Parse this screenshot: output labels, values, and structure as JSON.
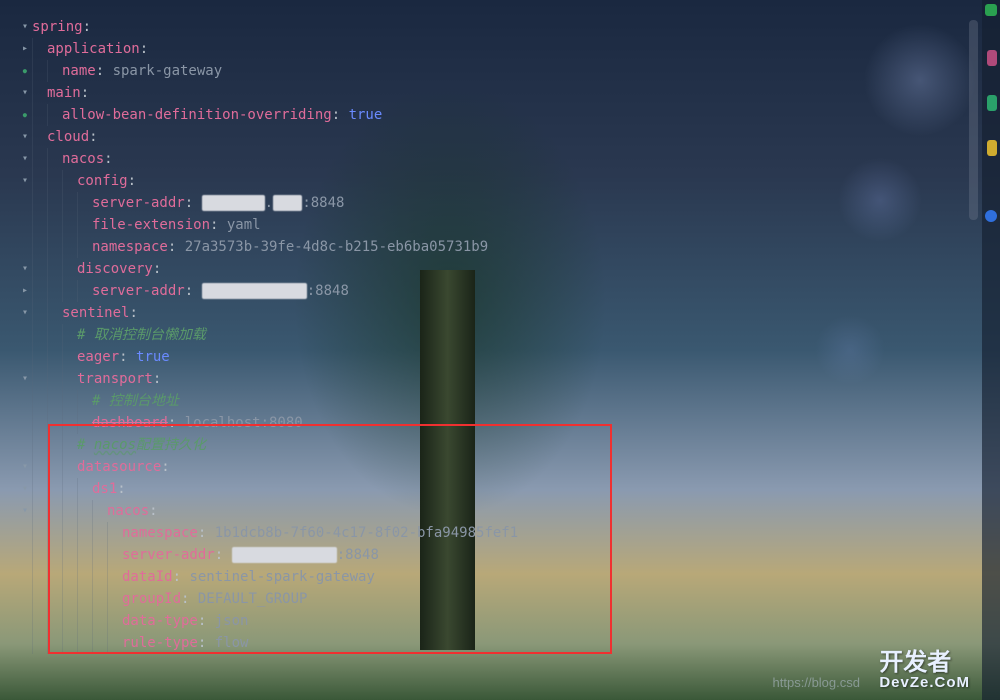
{
  "code": {
    "spring": {
      "application": {
        "name": "spark-gateway"
      },
      "main": {
        "allow_bean_def": "allow-bean-definition-overriding",
        "allow_bean_val": "true"
      },
      "cloud": {
        "nacos": {
          "config": {
            "server_addr_port": ":8848",
            "file_extension": "yaml",
            "namespace": "27a3573b-39fe-4d8c-b215-eb6ba05731b9"
          },
          "discovery": {
            "server_addr_port": ":8848"
          }
        },
        "sentinel": {
          "comment_eager": "# 取消控制台懒加载",
          "eager": "true",
          "transport": {
            "comment_dashboard": "# 控制台地址",
            "dashboard": "localhost:8080"
          },
          "comment_nacos_1": "# ",
          "comment_nacos_2": "nacos",
          "comment_nacos_3": "配置持久化",
          "datasource": {
            "ds1": {
              "nacos": {
                "namespace": "1b1dcb8b-7f60-4c17-8f02-bfa94985fef1",
                "server_addr_port": ":8848",
                "dataId": "sentinel-spark-gateway",
                "groupId": "DEFAULT_GROUP",
                "data_type": "json",
                "rule_type": "flow"
              }
            }
          }
        }
      }
    }
  },
  "labels": {
    "spring": "spring",
    "application": "application",
    "name": "name",
    "main": "main",
    "cloud": "cloud",
    "nacos": "nacos",
    "config": "config",
    "server_addr": "server-addr",
    "file_extension": "file-extension",
    "namespace": "namespace",
    "discovery": "discovery",
    "sentinel": "sentinel",
    "eager": "eager",
    "transport": "transport",
    "dashboard": "dashboard",
    "datasource": "datasource",
    "ds1": "ds1",
    "dataId": "dataId",
    "groupId": "groupId",
    "data_type": "data-type",
    "rule_type": "rule-type"
  },
  "watermark": {
    "url": "https://blog.csd",
    "logo_top": "开发者",
    "logo_bottom": "DevZe.CoM"
  }
}
